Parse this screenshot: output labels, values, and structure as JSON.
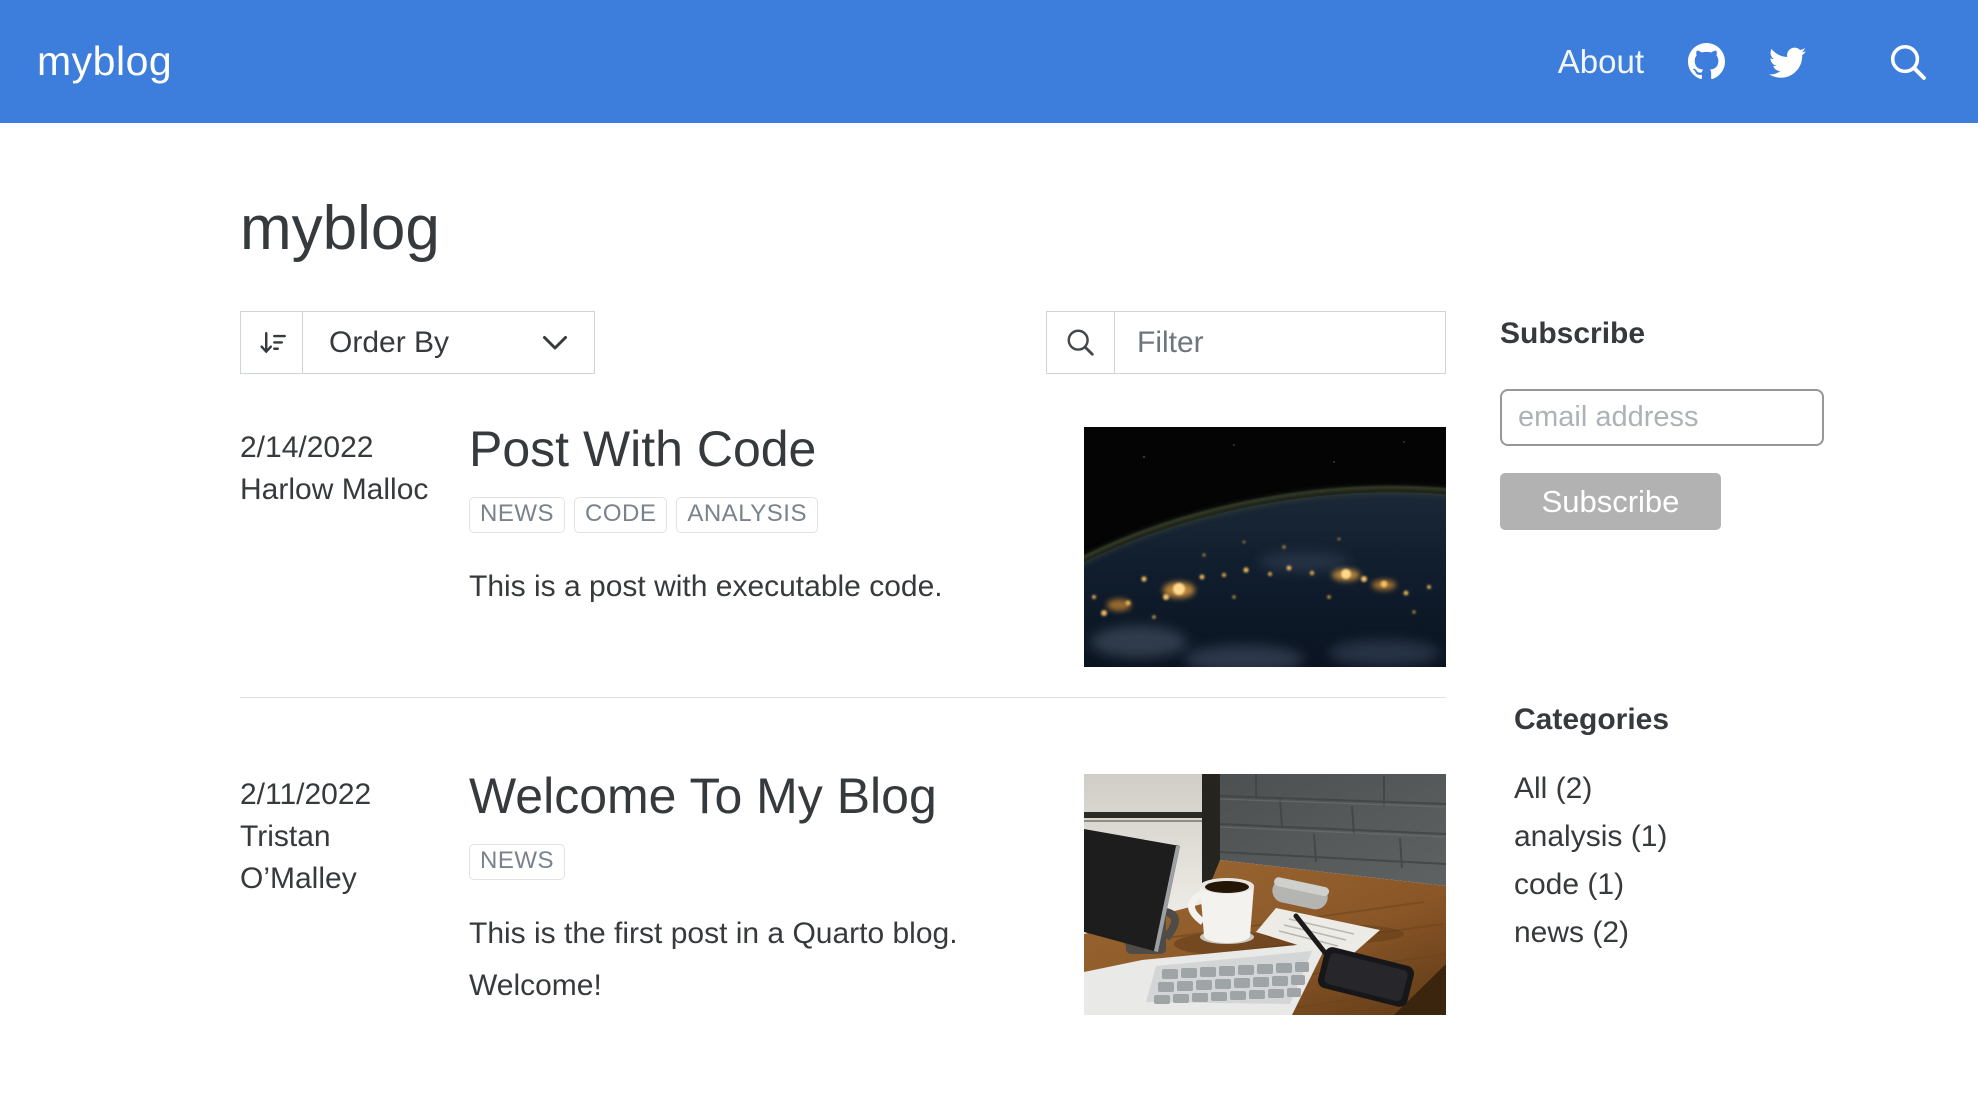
{
  "navbar": {
    "brand": "myblog",
    "about_label": "About",
    "icons": [
      "github-icon",
      "twitter-icon",
      "search-icon"
    ]
  },
  "page": {
    "title": "myblog"
  },
  "controls": {
    "order_by_label": "Order By",
    "order_by_icon": "sort-descending-icon",
    "filter_placeholder": "Filter",
    "filter_icon": "search-icon"
  },
  "posts": [
    {
      "date": "2/14/2022",
      "author": "Harlow Malloc",
      "title": "Post With Code",
      "tags": [
        "NEWS",
        "CODE",
        "ANALYSIS"
      ],
      "description": "This is a post with executable code.",
      "image_alt": "earth-at-night-from-space"
    },
    {
      "date": "2/11/2022",
      "author": "Tristan O’Malley",
      "title": "Welcome To My Blog",
      "tags": [
        "NEWS"
      ],
      "description": "This is the first post in a Quarto blog. Welcome!",
      "image_alt": "desk-with-laptop-coffee-notepad-phone"
    }
  ],
  "sidebar": {
    "subscribe_title": "Subscribe",
    "email_placeholder": "email address",
    "subscribe_button": "Subscribe",
    "categories_title": "Categories",
    "categories": [
      "All (2)",
      "analysis (1)",
      "code (1)",
      "news (2)"
    ]
  },
  "colors": {
    "navbar_bg": "#3d7ddb",
    "text": "#373a3c",
    "muted": "#6d757d",
    "tag_text": "#7a828c",
    "border": "#dee2e6",
    "subscribe_button_bg": "#b2b2b2"
  }
}
